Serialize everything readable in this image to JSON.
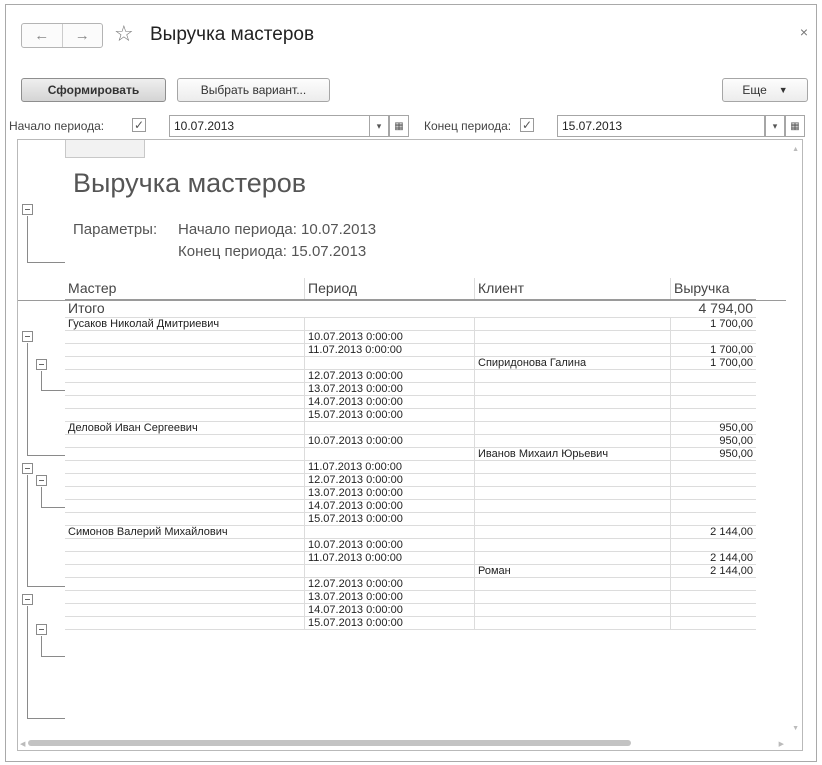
{
  "window": {
    "title": "Выручка мастеров",
    "back_icon": "←",
    "forward_icon": "→",
    "star_icon": "☆",
    "close_icon": "×"
  },
  "toolbar": {
    "generate_label": "Сформировать",
    "choose_variant_label": "Выбрать вариант...",
    "more_label": "Еще",
    "more_caret": "▼"
  },
  "period": {
    "start_label": "Начало периода:",
    "start_checked_glyph": "✓",
    "start_value": "10.07.2013",
    "end_label": "Конец периода:",
    "end_checked_glyph": "✓",
    "end_value": "15.07.2013",
    "dropdown_glyph": "▾",
    "calendar_glyph": "▦"
  },
  "report": {
    "title": "Выручка мастеров",
    "params_label": "Параметры:",
    "param_start": "Начало периода: 10.07.2013",
    "param_end": "Конец периода: 15.07.2013",
    "columns": [
      "Мастер",
      "Период",
      "Клиент",
      "Выручка"
    ],
    "total_label": "Итого",
    "total_value": "4 794,00",
    "rows": [
      [
        "Гусаков Николай Дмитриевич",
        "",
        "",
        "1 700,00"
      ],
      [
        "",
        "10.07.2013 0:00:00",
        "",
        ""
      ],
      [
        "",
        "11.07.2013 0:00:00",
        "",
        "1 700,00"
      ],
      [
        "",
        "",
        "Спиридонова Галина",
        "1 700,00"
      ],
      [
        "",
        "12.07.2013 0:00:00",
        "",
        ""
      ],
      [
        "",
        "13.07.2013 0:00:00",
        "",
        ""
      ],
      [
        "",
        "14.07.2013 0:00:00",
        "",
        ""
      ],
      [
        "",
        "15.07.2013 0:00:00",
        "",
        ""
      ],
      [
        "Деловой Иван Сергеевич",
        "",
        "",
        "950,00"
      ],
      [
        "",
        "10.07.2013 0:00:00",
        "",
        "950,00"
      ],
      [
        "",
        "",
        "Иванов Михаил Юрьевич",
        "950,00"
      ],
      [
        "",
        "11.07.2013 0:00:00",
        "",
        ""
      ],
      [
        "",
        "12.07.2013 0:00:00",
        "",
        ""
      ],
      [
        "",
        "13.07.2013 0:00:00",
        "",
        ""
      ],
      [
        "",
        "14.07.2013 0:00:00",
        "",
        ""
      ],
      [
        "",
        "15.07.2013 0:00:00",
        "",
        ""
      ],
      [
        "Симонов Валерий Михайлович",
        "",
        "",
        "2 144,00"
      ],
      [
        "",
        "10.07.2013 0:00:00",
        "",
        ""
      ],
      [
        "",
        "11.07.2013 0:00:00",
        "",
        "2 144,00"
      ],
      [
        "",
        "",
        "Роман",
        "2 144,00"
      ],
      [
        "",
        "12.07.2013 0:00:00",
        "",
        ""
      ],
      [
        "",
        "13.07.2013 0:00:00",
        "",
        ""
      ],
      [
        "",
        "14.07.2013 0:00:00",
        "",
        ""
      ],
      [
        "",
        "15.07.2013 0:00:00",
        "",
        ""
      ]
    ]
  }
}
